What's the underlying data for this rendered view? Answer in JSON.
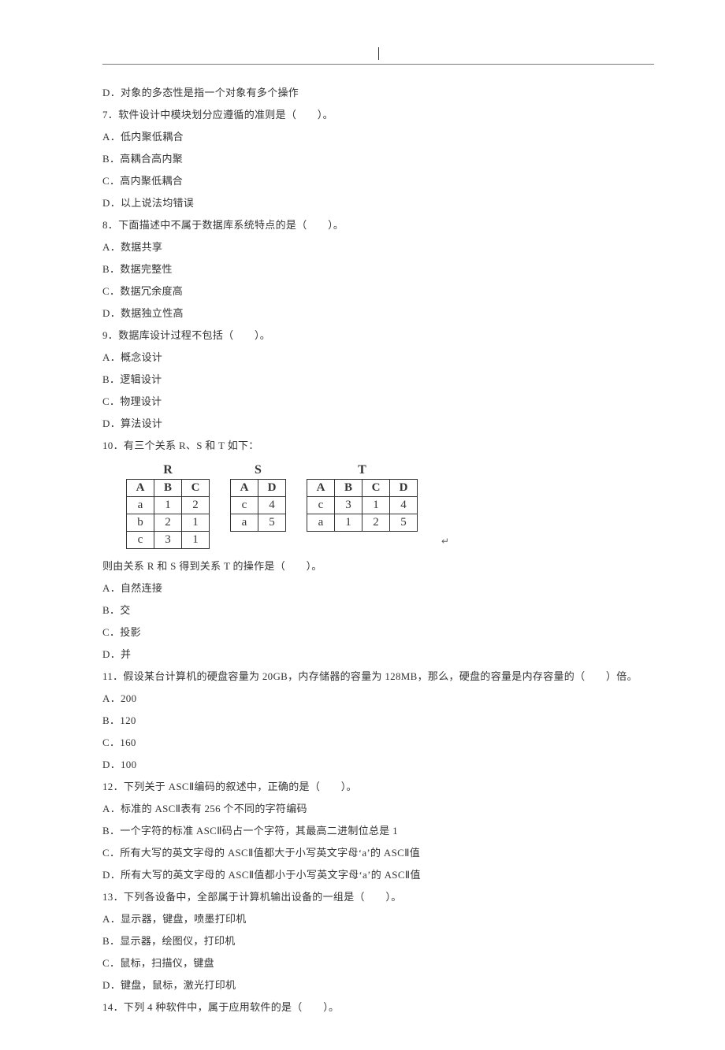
{
  "lines": {
    "l00": "D．对象的多态性是指一个对象有多个操作",
    "l01": "7．软件设计中模块划分应遵循的准则是（　　）。",
    "l02": "A．低内聚低耦合",
    "l03": "B．高耦合高内聚",
    "l04": "C．高内聚低耦合",
    "l05": "D．以上说法均错误",
    "l06": "8．下面描述中不属于数据库系统特点的是（　　）。",
    "l07": "A．数据共享",
    "l08": "B．数据完整性",
    "l09": "C．数据冗余度高",
    "l10": "D．数据独立性高",
    "l11": "9．数据库设计过程不包括（　　）。",
    "l12": "A．概念设计",
    "l13": "B．逻辑设计",
    "l14": "C．物理设计",
    "l15": "D．算法设计",
    "l16": "10．有三个关系 R、S 和 T 如下：",
    "l17": "则由关系 R 和 S 得到关系 T 的操作是（　　）。",
    "l18": "A．自然连接",
    "l19": "B．交",
    "l20": "C．投影",
    "l21": "D．并",
    "l22": "11．假设某台计算机的硬盘容量为 20GB，内存储器的容量为 128MB，那么，硬盘的容量是内存容量的（　　）倍。",
    "l23": "A．200",
    "l24": "B．120",
    "l25": "C．160",
    "l26": "D．100",
    "l27": "12．下列关于 ASCⅡ编码的叙述中，正确的是（　　）。",
    "l28": "A．标准的 ASCⅡ表有 256 个不同的字符编码",
    "l29": "B．一个字符的标准 ASCⅡ码占一个字符，其最高二进制位总是 1",
    "l30": "C．所有大写的英文字母的 ASCⅡ值都大于小写英文字母‘a’的 ASCⅡ值",
    "l31": "D．所有大写的英文字母的 ASCⅡ值都小于小写英文字母‘a’的 ASCⅡ值",
    "l32": "13．下列各设备中，全部属于计算机输出设备的一组是（　　）。",
    "l33": "A．显示器，键盘，喷墨打印机",
    "l34": "B．显示器，绘图仪，打印机",
    "l35": "C．鼠标，扫描仪，键盘",
    "l36": "D．键盘，鼠标，激光打印机",
    "l37": "14．下列 4 种软件中，属于应用软件的是（　　）。"
  },
  "tables": {
    "R": {
      "title": "R",
      "head": [
        "A",
        "B",
        "C"
      ],
      "rows": [
        [
          "a",
          "1",
          "2"
        ],
        [
          "b",
          "2",
          "1"
        ],
        [
          "c",
          "3",
          "1"
        ]
      ]
    },
    "S": {
      "title": "S",
      "head": [
        "A",
        "D"
      ],
      "rows": [
        [
          "c",
          "4"
        ],
        [
          "a",
          "5"
        ]
      ]
    },
    "T": {
      "title": "T",
      "head": [
        "A",
        "B",
        "C",
        "D"
      ],
      "rows": [
        [
          "c",
          "3",
          "1",
          "4"
        ],
        [
          "a",
          "1",
          "2",
          "5"
        ]
      ]
    }
  },
  "marker": "↵"
}
